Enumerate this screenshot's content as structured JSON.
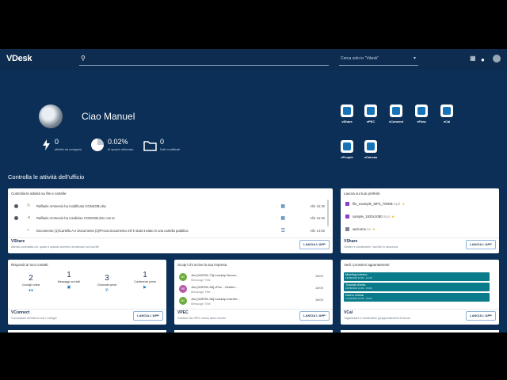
{
  "header": {
    "logo": "VDesk",
    "search_placeholder": "",
    "search_scope": "Cerca solo in \"Vdesk\"",
    "icons": [
      "search-icon",
      "grid-icon",
      "bell-icon",
      "user-avatar"
    ]
  },
  "profile": {
    "greeting": "Ciao Manuel",
    "stats": [
      {
        "value": "0",
        "label": "attività da svolgersi",
        "icon": "bolt-icon"
      },
      {
        "value": "0.02%",
        "label": "di spazio utilizzato",
        "icon": "pie-icon"
      },
      {
        "value": "0",
        "label": "Dati modificati",
        "icon": "folder-icon"
      }
    ]
  },
  "apps": [
    {
      "name": "vShare"
    },
    {
      "name": "vPEC"
    },
    {
      "name": "vConnect"
    },
    {
      "name": "vFlow"
    },
    {
      "name": "vCal"
    },
    {
      "name": "vPeople"
    },
    {
      "name": "vCanvas"
    }
  ],
  "section_title": "Controlla le attività dell'ufficio",
  "cards": {
    "activity": {
      "title": "Controlla le attività su file e cartelle",
      "rows": [
        {
          "text": "Raffaele Ammenio ha modificato CONSOB.xlsx",
          "time": "Alle 15:35",
          "type_icon": "refresh-icon"
        },
        {
          "text": "Raffaele Ammenio ha condiviso CONSOB.xlsx con te",
          "time": "Alle 15:35",
          "type_icon": "share-icon"
        },
        {
          "text": "Documento (1)/Cartella A e Documento (2)/Prova Documento mif è stato inviato in una cartella pubblica",
          "time": "Alle 14:55",
          "type_icon": "plus-icon"
        }
      ],
      "app_name": "VShare",
      "app_desc": "Attività controllata ciò, quale a quando avvenire ad attivare sui tuoi file",
      "launch": "LANCIA L'APP"
    },
    "favorites": {
      "title": "Lavora sui tuoi preferiti",
      "files": [
        {
          "name": "file_example_MP3_700KB",
          "ext": ".mp3",
          "color": "#8b3fc9"
        },
        {
          "name": "sample_1920x1080",
          "ext": ".mp4",
          "color": "#8b3fc9"
        },
        {
          "name": "welcome",
          "ext": ".txt",
          "color": "#7a8591"
        }
      ],
      "app_name": "VShare",
      "app_desc": "Gestire e condividere i tuoi file in sicurezza",
      "launch": "LANCIA L'APP"
    },
    "connect": {
      "title": "Rispondi ai tuoi contatti",
      "stats": [
        {
          "value": "2",
          "label": "Consigli online",
          "icon": "people-icon"
        },
        {
          "value": "1",
          "label": "Messaggi non letti",
          "icon": "chat-icon"
        },
        {
          "value": "3",
          "label": "Chiamate perse",
          "icon": "phone-icon"
        },
        {
          "value": "1",
          "label": "Conferenze perse",
          "icon": "video-icon"
        }
      ],
      "app_name": "VConnect",
      "app_desc": "Comunicare all'interno con i colleghi",
      "launch": "LANCIA L'APP"
    },
    "pec": {
      "title": "Scopri chi scrive la tua impresa",
      "rows": [
        {
          "badge": "MC",
          "badge_color": "#6aab3a",
          "subject": "Jira [VDESK-73] mockup Nuovo...",
          "msg": "Message Title",
          "date": "16/09"
        },
        {
          "badge": "RR",
          "badge_color": "#b35aa8",
          "subject": "Jira [VDESK-56] vPec - Gestire...",
          "msg": "Message Title",
          "date": "16/09"
        },
        {
          "badge": "MC",
          "badge_color": "#6aab3a",
          "subject": "Jira [VDESK-56] mockup inserire...",
          "msg": "Message Title",
          "date": "16/09"
        }
      ],
      "app_name": "VPEC",
      "app_desc": "Gestisce da vPEC senza alcun rischio",
      "launch": "LANCIA L'APP"
    },
    "cal": {
      "title": "Vedi i prossimi appuntamenti",
      "items": [
        {
          "title": "Meeting interno",
          "hours": "16/08/2020 16:00 - 13:30"
        },
        {
          "title": "Tutorial vDesk",
          "hours": "16/08/2020 14:00 - 15:00"
        },
        {
          "title": "Demo vDesk",
          "hours": "17/09/2020 15:00 - 16:00"
        }
      ],
      "app_name": "VCal",
      "app_desc": "Organizzare e condividere gli appuntamenti di lavoro",
      "launch": "LANCIA L'APP"
    }
  }
}
